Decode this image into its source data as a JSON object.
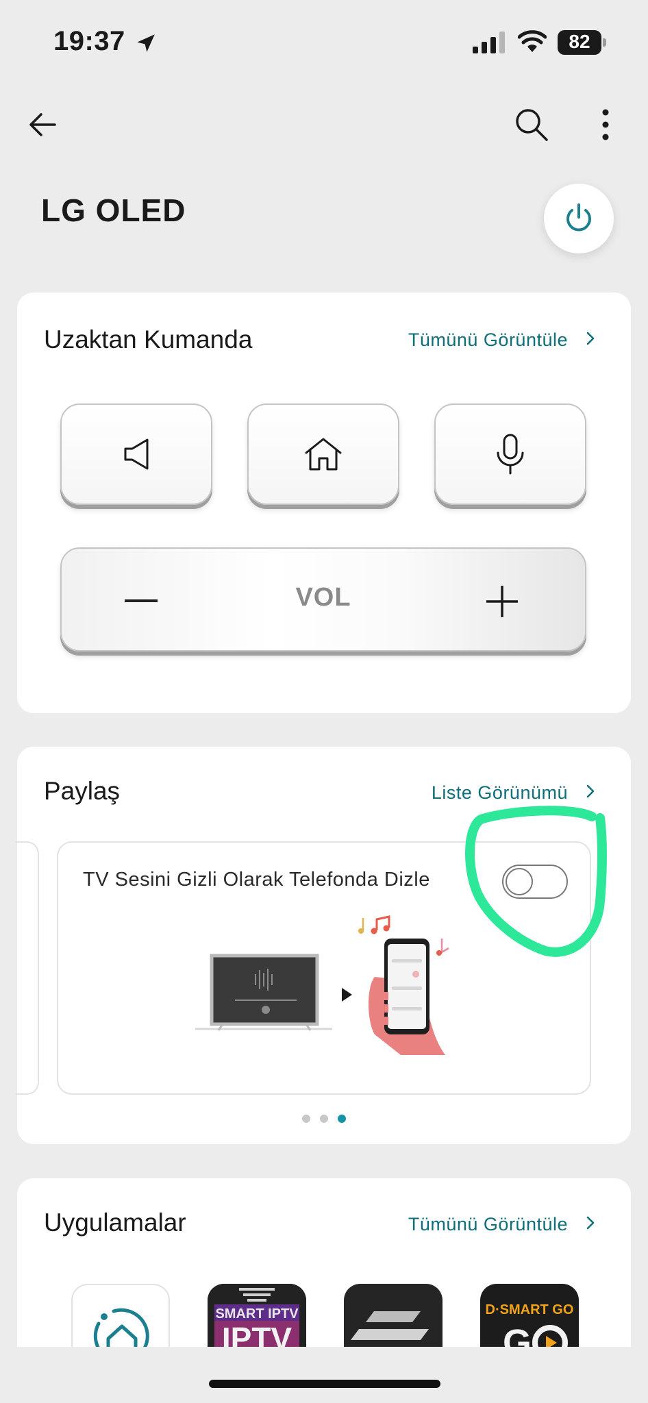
{
  "status_bar": {
    "time": "19:37",
    "battery": "82"
  },
  "header": {
    "title": "LG OLED"
  },
  "remote": {
    "title": "Uzaktan Kumanda",
    "link": "Tümünü Görüntüle",
    "buttons": [
      "speaker-icon",
      "home-icon",
      "microphone-icon"
    ],
    "volume_label": "VOL"
  },
  "share": {
    "title": "Paylaş",
    "link": "Liste Görünümü",
    "feature": {
      "title": "TV Sesini Gizli Olarak Telefonda Dizle",
      "toggle_on": false
    },
    "pager": {
      "count": 3,
      "active": 3
    }
  },
  "apps": {
    "title": "Uygulamalar",
    "link": "Tümünü Görüntüle",
    "items": [
      {
        "icon": "lg-thinq-home-icon"
      },
      {
        "icon": "smart-iptv-icon",
        "text": "SMART IPTV"
      },
      {
        "icon": "layers-app-icon"
      },
      {
        "icon": "dsmart-go-icon",
        "text": "D·SMART GO"
      }
    ]
  },
  "colors": {
    "accent": "#0e6e79",
    "power": "#1b7f8f",
    "annotation": "#2ee89a"
  }
}
